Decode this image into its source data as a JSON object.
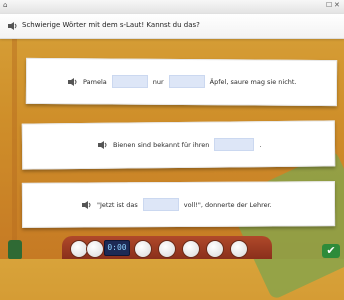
{
  "instruction": "Schwierige Wörter mit dem s-Laut! Kannst du das?",
  "sentences": [
    {
      "part1": "Pamela",
      "part2": "nur",
      "part3": "Äpfel, saure mag sie nicht."
    },
    {
      "part1": "Bienen sind bekannt für ihren",
      "part2": "."
    },
    {
      "part1": "\"Jetzt ist das",
      "part2": "voll!\", donnerte der Lehrer."
    }
  ],
  "toolbar": {
    "timer": "0:00"
  },
  "icons": {
    "speaker": "speaker-icon",
    "check": "check-icon"
  }
}
